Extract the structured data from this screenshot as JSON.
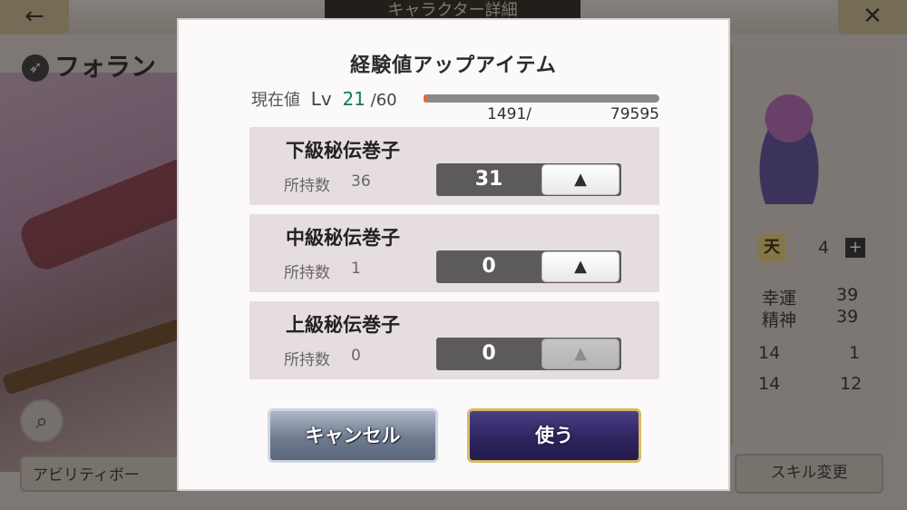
{
  "background": {
    "screen_title": "キャラクター詳細",
    "back_glyph": "←",
    "close_glyph": "✕",
    "character_name": "フォラン",
    "ability_button": "アビリティボー",
    "skill_button": "スキル変更",
    "rank_badge": "天",
    "rank_value": "4",
    "stats": [
      {
        "label": "幸運",
        "value": "39"
      },
      {
        "label": "精神",
        "value": "39"
      }
    ],
    "icon_stats": [
      "14",
      "1",
      "14",
      "12"
    ]
  },
  "modal": {
    "title": "経験値アップアイテム",
    "level": {
      "label": "現在値",
      "lv_word": "Lv",
      "current": "21",
      "max": "/60"
    },
    "exp": {
      "current": "1491/",
      "max": "79595",
      "progress": 0.019
    },
    "items": [
      {
        "name": "下級秘伝巻子",
        "owned_label": "所持数",
        "owned": "36",
        "quantity": "31",
        "up_glyph": "▲",
        "up_enabled": true
      },
      {
        "name": "中級秘伝巻子",
        "owned_label": "所持数",
        "owned": "1",
        "quantity": "0",
        "up_glyph": "▲",
        "up_enabled": true
      },
      {
        "name": "上級秘伝巻子",
        "owned_label": "所持数",
        "owned": "0",
        "quantity": "0",
        "up_glyph": "▲",
        "up_enabled": false
      }
    ],
    "cancel_label": "キャンセル",
    "use_label": "使う"
  },
  "colors": {
    "level_accent": "#0f7a62",
    "exp_fill": "#e36b3a",
    "use_border": "#d7b867"
  }
}
